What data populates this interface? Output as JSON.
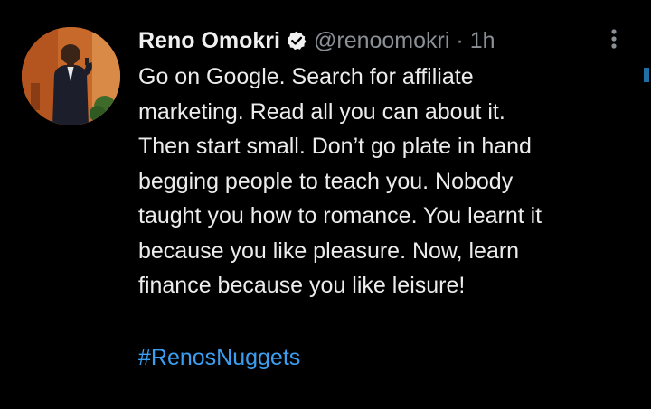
{
  "tweet": {
    "author_name": "Reno Omokri",
    "handle": "@renoomokri",
    "separator": "·",
    "time": "1h",
    "body_lines": [
      "Go on Google. Search for affiliate",
      "marketing. Read all you can about it.",
      "Then start small. Don’t go plate in hand",
      "begging people to teach you. Nobody",
      "taught you how to romance. You learnt it",
      "because you like pleasure. Now, learn",
      "finance because you like leisure!"
    ],
    "hashtag": "#RenosNuggets"
  },
  "icons": {
    "avatar": "profile-photo",
    "verified": "verified-badge-icon",
    "more": "more-vertical-icon"
  },
  "colors": {
    "background": "#000000",
    "text": "#ececec",
    "muted": "#8b9097",
    "hashtag": "#3c9ef0"
  }
}
